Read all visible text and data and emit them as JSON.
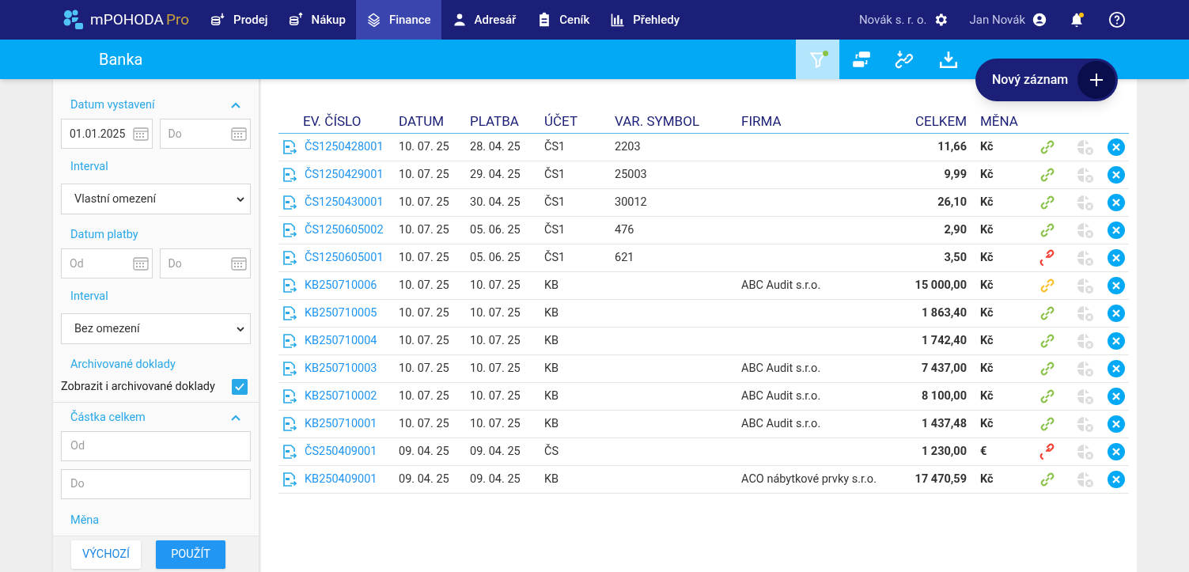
{
  "app": {
    "logo_main": "mPOHODA",
    "logo_suffix": "Pro"
  },
  "nav": [
    {
      "label": "Prodej",
      "selected": false
    },
    {
      "label": "Nákup",
      "selected": false
    },
    {
      "label": "Finance",
      "selected": true
    },
    {
      "label": "Adresář",
      "selected": false
    },
    {
      "label": "Ceník",
      "selected": false
    },
    {
      "label": "Přehledy",
      "selected": false
    }
  ],
  "company": "Novák s. r. o.",
  "user": "Jan Novák",
  "notifications_unread": true,
  "page_title": "Banka",
  "toolbar": [
    {
      "selected": true,
      "indicator": true
    },
    {
      "selected": false,
      "indicator": false
    },
    {
      "selected": false,
      "indicator": false
    },
    {
      "selected": false,
      "indicator": false
    }
  ],
  "new_button": "Nový záznam",
  "filters": {
    "issue_date": {
      "title": "Datum vystavení",
      "expanded": true,
      "from": {
        "value": "01.01.2025"
      },
      "to": {
        "placeholder": "Do"
      }
    },
    "interval1": {
      "label": "Interval",
      "value": "Vlastní omezení"
    },
    "pay_date": {
      "title": "Datum platby",
      "from": {
        "placeholder": "Od"
      },
      "to": {
        "placeholder": "Do"
      }
    },
    "interval2": {
      "label": "Interval",
      "value": "Bez omezení"
    },
    "archived": {
      "title": "Archivované doklady",
      "label": "Zobrazit i archivované doklady",
      "checked": true
    },
    "amount": {
      "title": "Částka celkem",
      "expanded": true,
      "from": {
        "placeholder": "Od"
      },
      "to": {
        "placeholder": "Do"
      }
    },
    "currency": {
      "title": "Měna"
    },
    "buttons": {
      "reset": "VÝCHOZÍ",
      "apply": "POUŽÍT"
    }
  },
  "table": {
    "columns": [
      "EV. ČÍSLO",
      "DATUM",
      "PLATBA",
      "ÚČET",
      "VAR. SYMBOL",
      "FIRMA",
      "CELKEM",
      "MĚNA"
    ],
    "rows": [
      {
        "number": "ČS1250428001",
        "date": "10. 07. 25",
        "payment": "28. 04. 25",
        "account": "ČS1",
        "var_symbol": "2203",
        "company": "",
        "total": "11,66",
        "currency": "Kč",
        "kind": "linked"
      },
      {
        "number": "ČS1250429001",
        "date": "10. 07. 25",
        "payment": "29. 04. 25",
        "account": "ČS1",
        "var_symbol": "25003",
        "company": "",
        "total": "9,99",
        "currency": "Kč",
        "kind": "linked"
      },
      {
        "number": "ČS1250430001",
        "date": "10. 07. 25",
        "payment": "30. 04. 25",
        "account": "ČS1",
        "var_symbol": "30012",
        "company": "",
        "total": "26,10",
        "currency": "Kč",
        "kind": "linked"
      },
      {
        "number": "ČS1250605002",
        "date": "10. 07. 25",
        "payment": "05. 06. 25",
        "account": "ČS1",
        "var_symbol": "476",
        "company": "",
        "total": "2,90",
        "currency": "Kč",
        "kind": "linked"
      },
      {
        "number": "ČS1250605001",
        "date": "10. 07. 25",
        "payment": "05. 06. 25",
        "account": "ČS1",
        "var_symbol": "621",
        "company": "",
        "total": "3,50",
        "currency": "Kč",
        "kind": "broken"
      },
      {
        "number": "KB250710006",
        "date": "10. 07. 25",
        "payment": "10. 07. 25",
        "account": "KB",
        "var_symbol": "",
        "company": "ABC Audit s.r.o.",
        "total": "15 000,00",
        "currency": "Kč",
        "kind": "partial"
      },
      {
        "number": "KB250710005",
        "date": "10. 07. 25",
        "payment": "10. 07. 25",
        "account": "KB",
        "var_symbol": "",
        "company": "",
        "total": "1 863,40",
        "currency": "Kč",
        "kind": "linked"
      },
      {
        "number": "KB250710004",
        "date": "10. 07. 25",
        "payment": "10. 07. 25",
        "account": "KB",
        "var_symbol": "",
        "company": "",
        "total": "1 742,40",
        "currency": "Kč",
        "kind": "linked"
      },
      {
        "number": "KB250710003",
        "date": "10. 07. 25",
        "payment": "10. 07. 25",
        "account": "KB",
        "var_symbol": "",
        "company": "ABC Audit s.r.o.",
        "total": "7 437,00",
        "currency": "Kč",
        "kind": "linked"
      },
      {
        "number": "KB250710002",
        "date": "10. 07. 25",
        "payment": "10. 07. 25",
        "account": "KB",
        "var_symbol": "",
        "company": "ABC Audit s.r.o.",
        "total": "8 100,00",
        "currency": "Kč",
        "kind": "linked"
      },
      {
        "number": "KB250710001",
        "date": "10. 07. 25",
        "payment": "10. 07. 25",
        "account": "KB",
        "var_symbol": "",
        "company": "ABC Audit s.r.o.",
        "total": "1 437,48",
        "currency": "Kč",
        "kind": "linked"
      },
      {
        "number": "ČS250409001",
        "date": "09. 04. 25",
        "payment": "09. 04. 25",
        "account": "ČS",
        "var_symbol": "",
        "company": "",
        "total": "1 230,00",
        "currency": "€",
        "kind": "broken"
      },
      {
        "number": "KB250409001",
        "date": "09. 04. 25",
        "payment": "09. 04. 25",
        "account": "KB",
        "var_symbol": "",
        "company": "ACO nábytkové prvky s.r.o.",
        "total": "17 470,59",
        "currency": "Kč",
        "kind": "linked"
      }
    ]
  }
}
